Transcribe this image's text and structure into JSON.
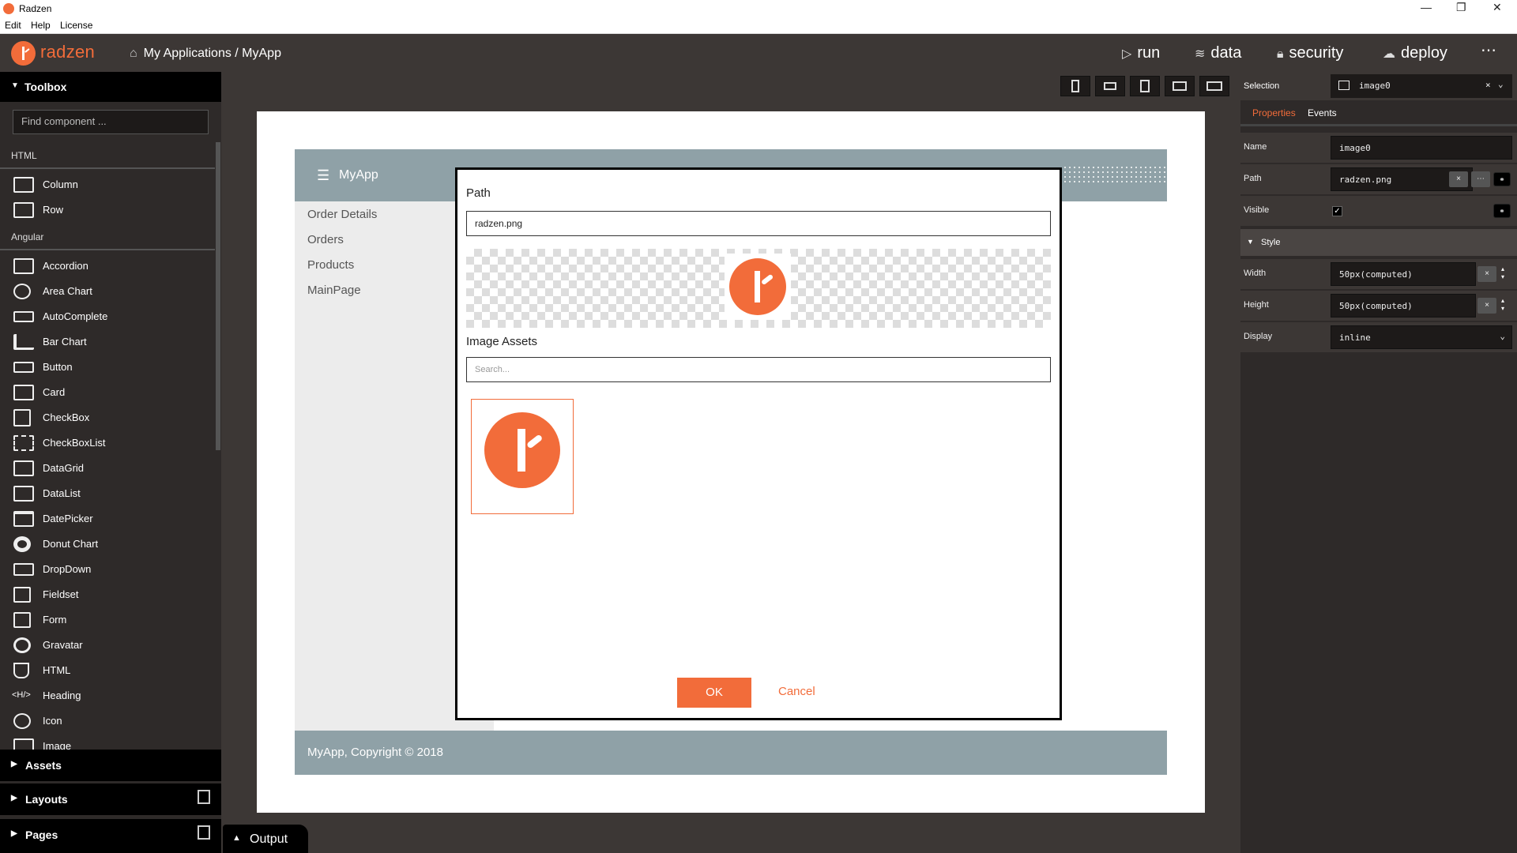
{
  "window": {
    "title": "Radzen",
    "controls": [
      "minimize-icon",
      "restore-icon",
      "close-icon"
    ]
  },
  "menu": {
    "items": [
      "Edit",
      "Help",
      "License"
    ]
  },
  "appbar": {
    "brand": "radzen",
    "breadcrumb": "My Applications / MyApp",
    "actions": [
      {
        "label": "run",
        "icon": "play-icon"
      },
      {
        "label": "data",
        "icon": "layers-icon"
      },
      {
        "label": "security",
        "icon": "lock-icon"
      },
      {
        "label": "deploy",
        "icon": "cloud-upload-icon"
      }
    ],
    "more": "⋯"
  },
  "toolbox": {
    "title": "Toolbox",
    "search_placeholder": "Find component ...",
    "sections": {
      "html": {
        "label": "HTML",
        "items": [
          "Column",
          "Row"
        ]
      },
      "angular": {
        "label": "Angular",
        "items": [
          "Accordion",
          "Area Chart",
          "AutoComplete",
          "Bar Chart",
          "Button",
          "Card",
          "CheckBox",
          "CheckBoxList",
          "DataGrid",
          "DataList",
          "DatePicker",
          "Donut Chart",
          "DropDown",
          "Fieldset",
          "Form",
          "Gravatar",
          "HTML",
          "Heading",
          "Icon",
          "Image"
        ]
      }
    },
    "panels": {
      "assets": "Assets",
      "layouts": "Layouts",
      "pages": "Pages"
    }
  },
  "canvas": {
    "app_name": "MyApp",
    "nav": [
      "Order Details",
      "Orders",
      "Products",
      "MainPage"
    ],
    "footer": "MyApp, Copyright © 2018"
  },
  "dialog": {
    "path_label": "Path",
    "path_value": "radzen.png",
    "assets_label": "Image Assets",
    "search_placeholder": "Search...",
    "ok": "OK",
    "cancel": "Cancel"
  },
  "output": {
    "label": "Output"
  },
  "properties": {
    "selection_label": "Selection",
    "selection_value": "image0",
    "tabs": {
      "properties": "Properties",
      "events": "Events"
    },
    "name_label": "Name",
    "name_value": "image0",
    "path_label": "Path",
    "path_value": "radzen.png",
    "visible_label": "Visible",
    "style_label": "Style",
    "width_label": "Width",
    "width_value": "50px(computed)",
    "height_label": "Height",
    "height_value": "50px(computed)",
    "display_label": "Display",
    "display_value": "inline"
  },
  "colors": {
    "accent": "#f26c3a",
    "header": "#8fa1a7",
    "panel": "#2e2a29"
  }
}
